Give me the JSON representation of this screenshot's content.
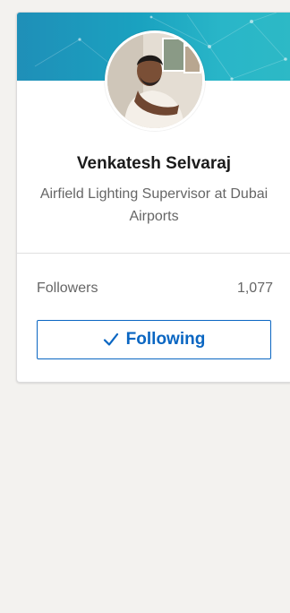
{
  "profile": {
    "name": "Venkatesh Selvaraj",
    "headline": "Airfield Lighting Supervisor at Dubai Airports"
  },
  "stats": {
    "followers_label": "Followers",
    "followers_count": "1,077"
  },
  "actions": {
    "follow_state_label": "Following"
  },
  "icons": {
    "follow_state": "check-icon"
  },
  "colors": {
    "accent": "#0a66c2",
    "banner_start": "#1f8fb8",
    "banner_end": "#2db9c6"
  }
}
